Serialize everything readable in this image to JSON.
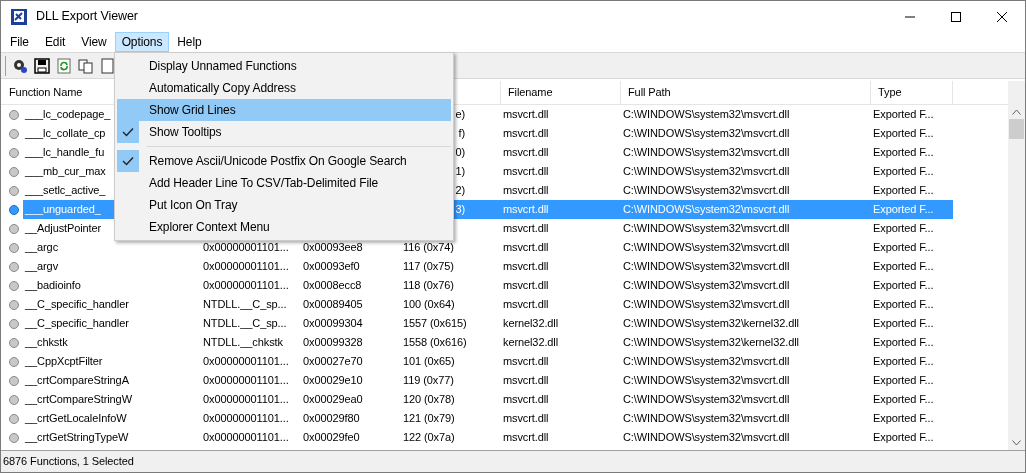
{
  "window": {
    "title": "DLL Export Viewer"
  },
  "menu_bar": [
    {
      "label": "File",
      "selected": false
    },
    {
      "label": "Edit",
      "selected": false
    },
    {
      "label": "View",
      "selected": false
    },
    {
      "label": "Options",
      "selected": true
    },
    {
      "label": "Help",
      "selected": false
    }
  ],
  "options_menu": [
    {
      "kind": "item",
      "label": "Display Unnamed Functions",
      "checked": false,
      "selected": false
    },
    {
      "kind": "item",
      "label": "Automatically Copy Address",
      "checked": false,
      "selected": false
    },
    {
      "kind": "item",
      "label": "Show Grid Lines",
      "checked": false,
      "selected": true
    },
    {
      "kind": "item",
      "label": "Show Tooltips",
      "checked": true,
      "selected": false
    },
    {
      "kind": "separator"
    },
    {
      "kind": "item",
      "label": "Remove Ascii/Unicode Postfix On Google Search",
      "checked": true,
      "selected": false
    },
    {
      "kind": "item",
      "label": "Add Header Line To CSV/Tab-Delimited File",
      "checked": false,
      "selected": false
    },
    {
      "kind": "item",
      "label": "Put Icon On Tray",
      "checked": false,
      "selected": false
    },
    {
      "kind": "item",
      "label": "Explorer Context Menu",
      "checked": false,
      "selected": false
    }
  ],
  "table": {
    "columns": [
      "Function Name",
      "Filename",
      "Full Path",
      "Type"
    ],
    "rows": [
      {
        "function": "___lc_codepage_",
        "ordinal": "e)",
        "filename": "msvcrt.dll",
        "full_path": "C:\\WINDOWS\\system32\\msvcrt.dll",
        "type": "Exported F...",
        "selected": false
      },
      {
        "function": "___lc_collate_cp",
        "ordinal": "f)",
        "filename": "msvcrt.dll",
        "full_path": "C:\\WINDOWS\\system32\\msvcrt.dll",
        "type": "Exported F...",
        "selected": false
      },
      {
        "function": "___lc_handle_fu",
        "ordinal": "0)",
        "filename": "msvcrt.dll",
        "full_path": "C:\\WINDOWS\\system32\\msvcrt.dll",
        "type": "Exported F...",
        "selected": false
      },
      {
        "function": "___mb_cur_max",
        "ordinal": "1)",
        "filename": "msvcrt.dll",
        "full_path": "C:\\WINDOWS\\system32\\msvcrt.dll",
        "type": "Exported F...",
        "selected": false
      },
      {
        "function": "___setlc_active_",
        "ordinal": "2)",
        "filename": "msvcrt.dll",
        "full_path": "C:\\WINDOWS\\system32\\msvcrt.dll",
        "type": "Exported F...",
        "selected": false
      },
      {
        "function": "___unguarded_",
        "ordinal": "3)",
        "filename": "msvcrt.dll",
        "full_path": "C:\\WINDOWS\\system32\\msvcrt.dll",
        "type": "Exported F...",
        "selected": true
      },
      {
        "function": "__AdjustPointer",
        "filename": "msvcrt.dll",
        "full_path": "C:\\WINDOWS\\system32\\msvcrt.dll",
        "type": "Exported F...",
        "selected": false
      },
      {
        "function": "__argc",
        "address": "0x00000001101...",
        "relative_address": "0x00093ee8",
        "ordinal": "116 (0x74)",
        "filename": "msvcrt.dll",
        "full_path": "C:\\WINDOWS\\system32\\msvcrt.dll",
        "type": "Exported F...",
        "selected": false
      },
      {
        "function": "__argv",
        "address": "0x00000001101...",
        "relative_address": "0x00093ef0",
        "ordinal": "117 (0x75)",
        "filename": "msvcrt.dll",
        "full_path": "C:\\WINDOWS\\system32\\msvcrt.dll",
        "type": "Exported F...",
        "selected": false
      },
      {
        "function": "__badioinfo",
        "address": "0x00000001101...",
        "relative_address": "0x0008ecc8",
        "ordinal": "118 (0x76)",
        "filename": "msvcrt.dll",
        "full_path": "C:\\WINDOWS\\system32\\msvcrt.dll",
        "type": "Exported F...",
        "selected": false
      },
      {
        "function": "__C_specific_handler",
        "address": "NTDLL.__C_sp...",
        "relative_address": "0x00089405",
        "ordinal": "100 (0x64)",
        "filename": "msvcrt.dll",
        "full_path": "C:\\WINDOWS\\system32\\msvcrt.dll",
        "type": "Exported F...",
        "selected": false
      },
      {
        "function": "__C_specific_handler",
        "address": "NTDLL.__C_sp...",
        "relative_address": "0x00099304",
        "ordinal": "1557 (0x615)",
        "filename": "kernel32.dll",
        "full_path": "C:\\WINDOWS\\system32\\kernel32.dll",
        "type": "Exported F...",
        "selected": false
      },
      {
        "function": "__chkstk",
        "address": "NTDLL.__chkstk",
        "relative_address": "0x00099328",
        "ordinal": "1558 (0x616)",
        "filename": "kernel32.dll",
        "full_path": "C:\\WINDOWS\\system32\\kernel32.dll",
        "type": "Exported F...",
        "selected": false
      },
      {
        "function": "__CppXcptFilter",
        "address": "0x00000001101...",
        "relative_address": "0x00027e70",
        "ordinal": "101 (0x65)",
        "filename": "msvcrt.dll",
        "full_path": "C:\\WINDOWS\\system32\\msvcrt.dll",
        "type": "Exported F...",
        "selected": false
      },
      {
        "function": "__crtCompareStringA",
        "address": "0x00000001101...",
        "relative_address": "0x00029e10",
        "ordinal": "119 (0x77)",
        "filename": "msvcrt.dll",
        "full_path": "C:\\WINDOWS\\system32\\msvcrt.dll",
        "type": "Exported F...",
        "selected": false
      },
      {
        "function": "__crtCompareStringW",
        "address": "0x00000001101...",
        "relative_address": "0x00029ea0",
        "ordinal": "120 (0x78)",
        "filename": "msvcrt.dll",
        "full_path": "C:\\WINDOWS\\system32\\msvcrt.dll",
        "type": "Exported F...",
        "selected": false
      },
      {
        "function": "__crtGetLocaleInfoW",
        "address": "0x00000001101...",
        "relative_address": "0x00029f80",
        "ordinal": "121 (0x79)",
        "filename": "msvcrt.dll",
        "full_path": "C:\\WINDOWS\\system32\\msvcrt.dll",
        "type": "Exported F...",
        "selected": false
      },
      {
        "function": "__crtGetStringTypeW",
        "address": "0x00000001101...",
        "relative_address": "0x00029fe0",
        "ordinal": "122 (0x7a)",
        "filename": "msvcrt.dll",
        "full_path": "C:\\WINDOWS\\system32\\msvcrt.dll",
        "type": "Exported F...",
        "selected": false
      }
    ]
  },
  "status_bar": "6876 Functions, 1 Selected"
}
